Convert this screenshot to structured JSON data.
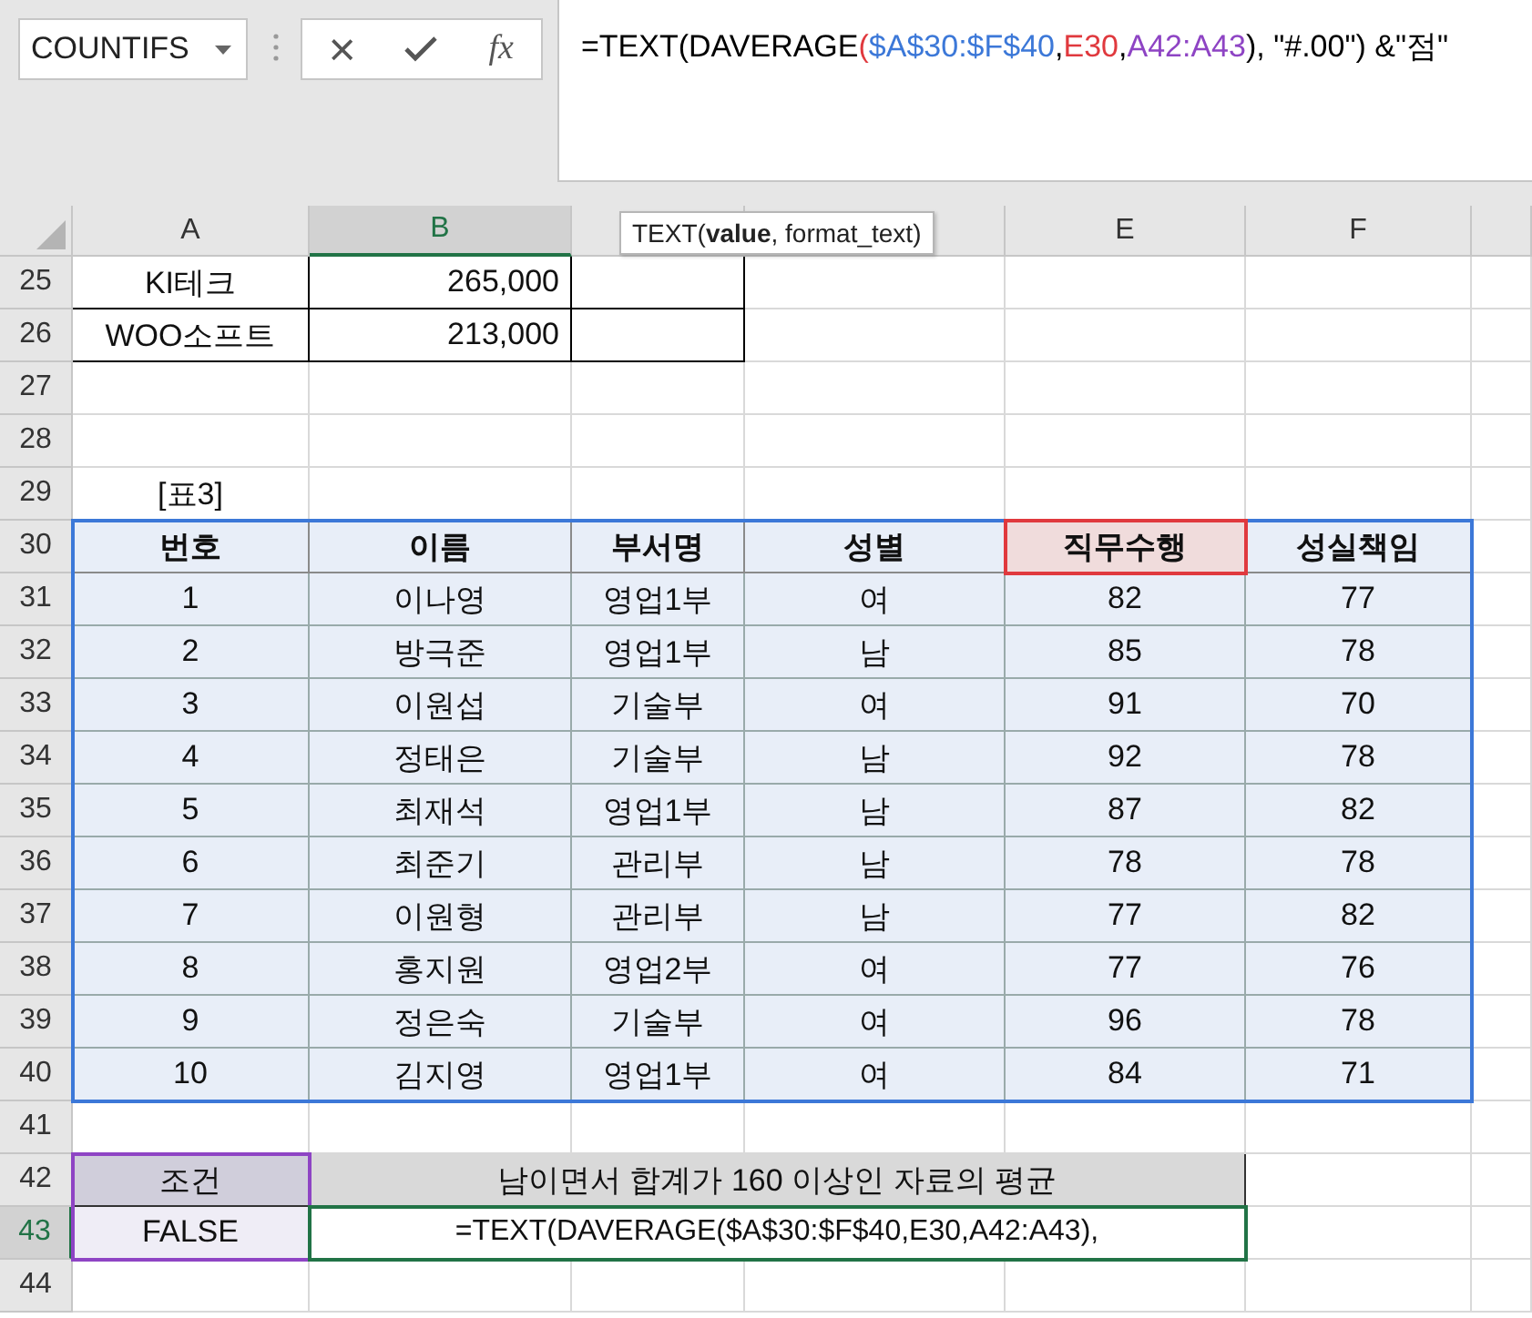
{
  "name_box": {
    "value": "COUNTIFS"
  },
  "formula_bar": {
    "cancel": "×",
    "function_label": "fx",
    "segments": [
      {
        "text": "=TEXT(DAVERAGE",
        "color": "#000000"
      },
      {
        "text": "(",
        "color": "#e0393e"
      },
      {
        "text": "$A$30:$F$40",
        "color": "#3c78d8"
      },
      {
        "text": ",",
        "color": "#000000"
      },
      {
        "text": "E30",
        "color": "#e0393e"
      },
      {
        "text": ",",
        "color": "#000000"
      },
      {
        "text": "A42:A43",
        "color": "#8e44c4"
      },
      {
        "text": "), \"#.00\") &\"점\"",
        "color": "#000000"
      }
    ]
  },
  "tooltip": {
    "text": "TEXT(**value**, format_text)"
  },
  "columns": [
    {
      "label": "A",
      "selected": false
    },
    {
      "label": "B",
      "selected": true
    },
    {
      "selected": false
    },
    {
      "selected": false
    },
    {
      "label": "E",
      "selected": false
    },
    {
      "label": "F",
      "selected": false
    }
  ],
  "rows": [
    {
      "number": "25",
      "selected": false,
      "kind": "bordered",
      "cells": [
        {
          "text": "KI테크"
        },
        {
          "text": "265,000",
          "numeric": true
        }
      ]
    },
    {
      "number": "26",
      "selected": false,
      "kind": "bordered",
      "cells": [
        {
          "text": "WOO소프트"
        },
        {
          "text": "213,000",
          "numeric": true
        }
      ]
    },
    {
      "number": "27",
      "selected": false,
      "kind": "plain",
      "cells": []
    },
    {
      "number": "28",
      "selected": false,
      "kind": "plain",
      "cells": []
    },
    {
      "number": "29",
      "selected": false,
      "kind": "plain",
      "cells": [
        {
          "text": "[표3]"
        }
      ]
    },
    {
      "number": "30",
      "selected": false,
      "kind": "table-header",
      "cells": [
        {
          "text": "번호"
        },
        {
          "text": "이름"
        },
        {
          "text": "부서명"
        },
        {
          "text": "성별"
        },
        {
          "text": "직무수행"
        },
        {
          "text": "성실책임"
        }
      ]
    },
    {
      "number": "31",
      "selected": false,
      "kind": "table-row",
      "cells": [
        {
          "text": "1"
        },
        {
          "text": "이나영"
        },
        {
          "text": "영업1부"
        },
        {
          "text": "여"
        },
        {
          "text": "82"
        },
        {
          "text": "77"
        }
      ]
    },
    {
      "number": "32",
      "selected": false,
      "kind": "table-row",
      "cells": [
        {
          "text": "2"
        },
        {
          "text": "방극준"
        },
        {
          "text": "영업1부"
        },
        {
          "text": "남"
        },
        {
          "text": "85"
        },
        {
          "text": "78"
        }
      ]
    },
    {
      "number": "33",
      "selected": false,
      "kind": "table-row",
      "cells": [
        {
          "text": "3"
        },
        {
          "text": "이원섭"
        },
        {
          "text": "기술부"
        },
        {
          "text": "여"
        },
        {
          "text": "91"
        },
        {
          "text": "70"
        }
      ]
    },
    {
      "number": "34",
      "selected": false,
      "kind": "table-row",
      "cells": [
        {
          "text": "4"
        },
        {
          "text": "정태은"
        },
        {
          "text": "기술부"
        },
        {
          "text": "남"
        },
        {
          "text": "92"
        },
        {
          "text": "78"
        }
      ]
    },
    {
      "number": "35",
      "selected": false,
      "kind": "table-row",
      "cells": [
        {
          "text": "5"
        },
        {
          "text": "최재석"
        },
        {
          "text": "영업1부"
        },
        {
          "text": "남"
        },
        {
          "text": "87"
        },
        {
          "text": "82"
        }
      ]
    },
    {
      "number": "36",
      "selected": false,
      "kind": "table-row",
      "cells": [
        {
          "text": "6"
        },
        {
          "text": "최준기"
        },
        {
          "text": "관리부"
        },
        {
          "text": "남"
        },
        {
          "text": "78"
        },
        {
          "text": "78"
        }
      ]
    },
    {
      "number": "37",
      "selected": false,
      "kind": "table-row",
      "cells": [
        {
          "text": "7"
        },
        {
          "text": "이원형"
        },
        {
          "text": "관리부"
        },
        {
          "text": "남"
        },
        {
          "text": "77"
        },
        {
          "text": "82"
        }
      ]
    },
    {
      "number": "38",
      "selected": false,
      "kind": "table-row",
      "cells": [
        {
          "text": "8"
        },
        {
          "text": "홍지원"
        },
        {
          "text": "영업2부"
        },
        {
          "text": "여"
        },
        {
          "text": "77"
        },
        {
          "text": "76"
        }
      ]
    },
    {
      "number": "39",
      "selected": false,
      "kind": "table-row",
      "cells": [
        {
          "text": "9"
        },
        {
          "text": "정은숙"
        },
        {
          "text": "기술부"
        },
        {
          "text": "여"
        },
        {
          "text": "96"
        },
        {
          "text": "78"
        }
      ]
    },
    {
      "number": "40",
      "selected": false,
      "kind": "table-row",
      "cells": [
        {
          "text": "10"
        },
        {
          "text": "김지영"
        },
        {
          "text": "영업1부"
        },
        {
          "text": "여"
        },
        {
          "text": "84"
        },
        {
          "text": "71"
        }
      ]
    },
    {
      "number": "41",
      "selected": false,
      "kind": "plain",
      "cells": []
    },
    {
      "number": "42",
      "selected": false,
      "kind": "criteria-header",
      "cells": [
        {
          "text": "조건"
        },
        {
          "text": "남이면서 합계가 160 이상인 자료의 평균"
        }
      ]
    },
    {
      "number": "43",
      "selected": true,
      "kind": "criteria-row",
      "cells": [
        {
          "text": "FALSE"
        },
        {
          "text": "=TEXT(DAVERAGE($A$30:$F$40,E30,A42:A43),",
          "active": true
        }
      ]
    },
    {
      "number": "44",
      "selected": false,
      "kind": "plain",
      "cells": []
    }
  ]
}
